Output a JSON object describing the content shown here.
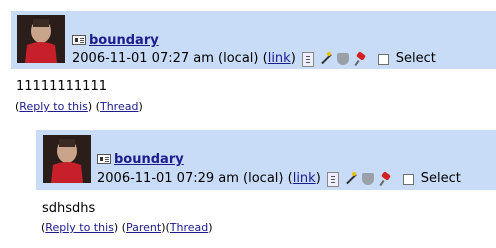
{
  "comments": [
    {
      "username": "boundary",
      "date": "2006-11-01 07:27 am (local)",
      "link_label": "link",
      "select_label": "Select",
      "body": "11111111111",
      "reply_label": "Reply to this",
      "thread_label": "Thread"
    },
    {
      "username": "boundary",
      "date": "2006-11-01 07:29 am (local)",
      "link_label": "link",
      "select_label": "Select",
      "body": "sdhsdhs",
      "reply_label": "Reply to this",
      "parent_label": "Parent",
      "thread_label": "Thread"
    }
  ],
  "colors": {
    "header_bg": "#c8dcf8",
    "link": "#1c1c8c"
  },
  "icons": [
    "userinfo-icon",
    "expand-icon",
    "magic-wand-icon",
    "shield-icon",
    "pushpin-icon"
  ]
}
